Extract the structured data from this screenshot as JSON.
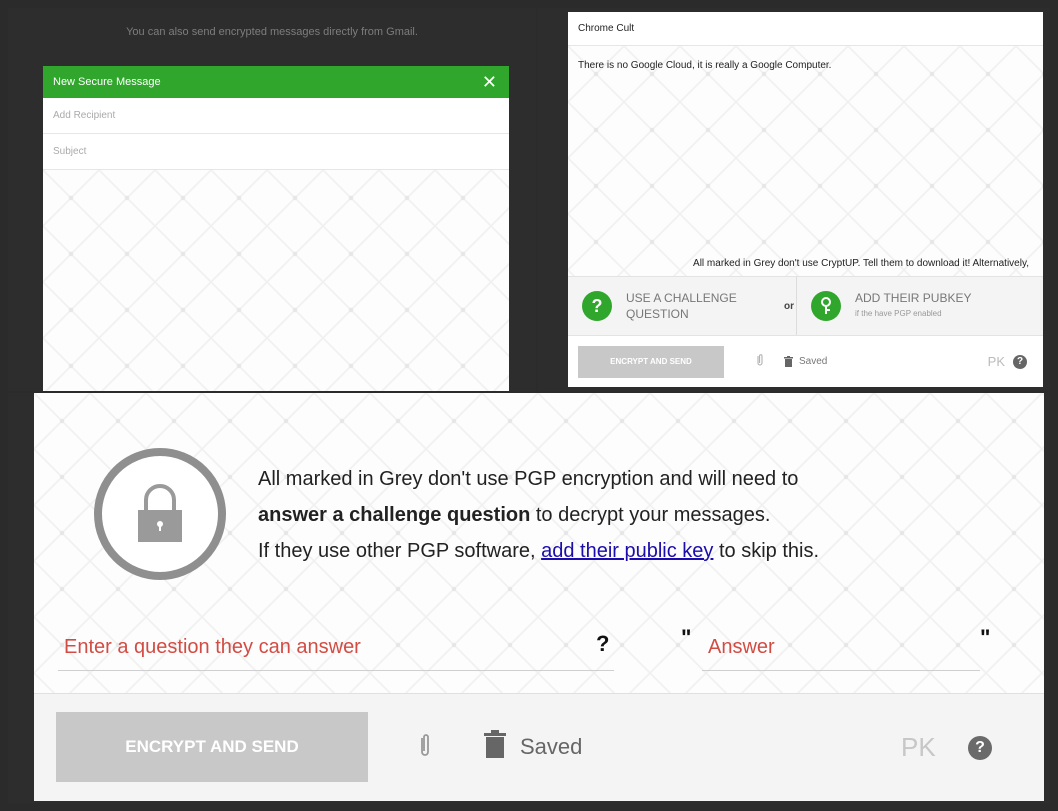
{
  "top_left": {
    "info_text": "You can also send encrypted messages directly from Gmail.",
    "compose": {
      "title": "New Secure Message",
      "close_glyph": "✕",
      "recipient_placeholder": "Add Recipient",
      "subject_placeholder": "Subject"
    }
  },
  "top_right": {
    "subject": "Chrome Cult",
    "message": "There is no Google Cloud, it is really a Google Computer.",
    "warning": "All marked in Grey don't use CryptUP. Tell them to download it! Alternatively,",
    "challenge_option": {
      "line1": "USE A CHALLENGE",
      "line2": "QUESTION",
      "icon_glyph": "?"
    },
    "or_label": "or",
    "pubkey_option": {
      "line1": "ADD THEIR PUBKEY",
      "sub": "if the have PGP enabled",
      "icon": "key-icon"
    },
    "encrypt_button": "ENCRYPT AND SEND",
    "saved": "Saved",
    "pk": "PK",
    "help_glyph": "?"
  },
  "bottom": {
    "desc_line1": "All marked in Grey don't use PGP encryption and will need to",
    "desc_line2_bold": "answer a challenge question",
    "desc_line2_rest": " to decrypt your messages.",
    "desc_line3_pre": "If they use other PGP software, ",
    "desc_link": "add their public key",
    "desc_line3_post": " to skip this.",
    "question_placeholder": "Enter a question they can answer",
    "question_mark": "?",
    "quote_open": "\"",
    "answer_placeholder": "Answer",
    "quote_close": "\"",
    "encrypt_button": "ENCRYPT AND SEND",
    "saved": "Saved",
    "pk": "PK",
    "help_glyph": "?"
  },
  "colors": {
    "green": "#31a62d",
    "dark_bg": "#2d2d2d",
    "question_red": "#d24c44",
    "link_blue": "#1a0dab",
    "button_grey": "#c8c8c8"
  }
}
